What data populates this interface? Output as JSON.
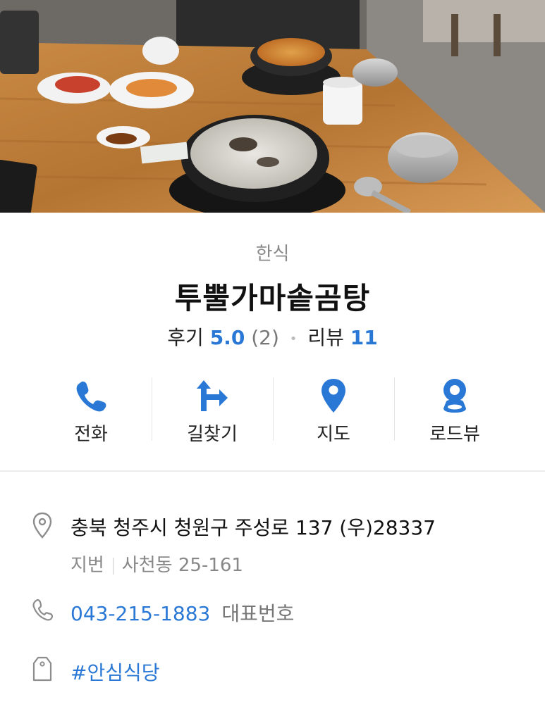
{
  "place": {
    "category": "한식",
    "name": "투뿔가마솥곰탕",
    "review_label": "후기",
    "review_score": "5.0",
    "review_count": "(2)",
    "blog_label": "리뷰",
    "blog_count": "11"
  },
  "actions": [
    {
      "label": "전화",
      "icon": "phone-icon"
    },
    {
      "label": "길찾기",
      "icon": "directions-icon"
    },
    {
      "label": "지도",
      "icon": "map-pin-icon"
    },
    {
      "label": "로드뷰",
      "icon": "roadview-icon"
    }
  ],
  "info": {
    "address": "충북 청주시 청원구 주성로 137 (우)28337",
    "jibun_label": "지번",
    "jibun": "사천동 25-161",
    "phone": "043-215-1883",
    "phone_note": "대표번호",
    "tag": "#안심식당"
  },
  "colors": {
    "accent": "#2a78d6",
    "muted": "#888888"
  }
}
